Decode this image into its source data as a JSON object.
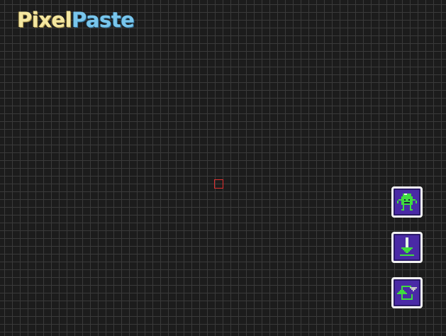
{
  "app": {
    "logo_part1": "Pixel",
    "logo_part2": "Paste"
  },
  "colors": {
    "background": "#1c1c1c",
    "grid_line": "#3a3a3a",
    "cursor_outline": "#e03030",
    "button_fill": "#4a2aa6",
    "button_border": "#f2f2f2",
    "icon_green": "#3fdc3f",
    "logo_yellow": "#f4e7a1",
    "logo_blue": "#79c6ec"
  },
  "toolbar": {
    "buttons": [
      {
        "icon": "robot-mascot-icon"
      },
      {
        "icon": "download-arrow-icon"
      },
      {
        "icon": "swap-arrows-icon"
      }
    ]
  }
}
